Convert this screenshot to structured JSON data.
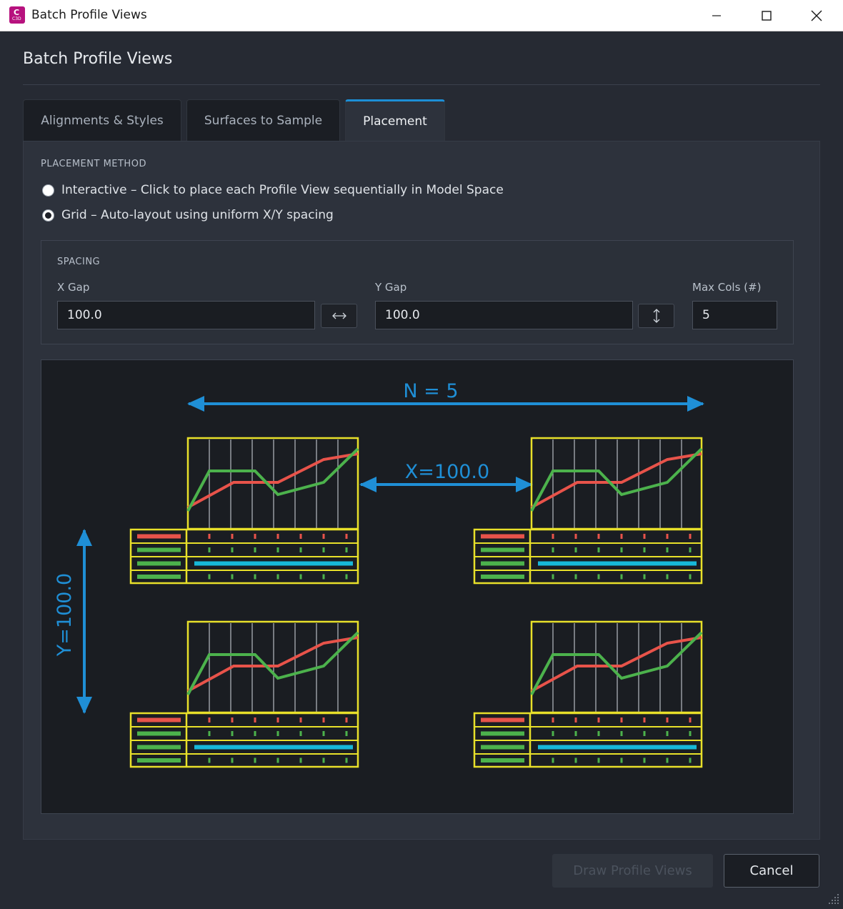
{
  "window": {
    "title": "Batch Profile Views",
    "app_icon_letter": "C",
    "app_icon_sub": "C3D"
  },
  "dialog": {
    "heading": "Batch Profile Views"
  },
  "tabs": [
    {
      "label": "Alignments & Styles",
      "active": false
    },
    {
      "label": "Surfaces to Sample",
      "active": false
    },
    {
      "label": "Placement",
      "active": true
    }
  ],
  "placement": {
    "section_label": "PLACEMENT METHOD",
    "options": [
      {
        "label": "Interactive – Click to place each Profile View sequentially in Model Space",
        "selected": false
      },
      {
        "label": "Grid – Auto-layout using uniform X/Y spacing",
        "selected": true
      }
    ]
  },
  "spacing": {
    "section_label": "SPACING",
    "x_gap_label": "X Gap",
    "x_gap_value": "100.0",
    "x_gap_icon": "horizontal-arrows-icon",
    "y_gap_label": "Y Gap",
    "y_gap_value": "100.0",
    "y_gap_icon": "vertical-arrows-icon",
    "max_cols_label": "Max Cols (#)",
    "max_cols_value": "5"
  },
  "preview": {
    "n_label": "N = 5",
    "x_label": "X=100.0",
    "y_label": "Y=100.0",
    "colors": {
      "frame": "#e8e02a",
      "red_line": "#e8534a",
      "green_line": "#4cb24c",
      "cyan_bar": "#17b8d8",
      "dimension": "#1f8fd6"
    }
  },
  "buttons": {
    "draw": "Draw Profile Views",
    "cancel": "Cancel"
  }
}
